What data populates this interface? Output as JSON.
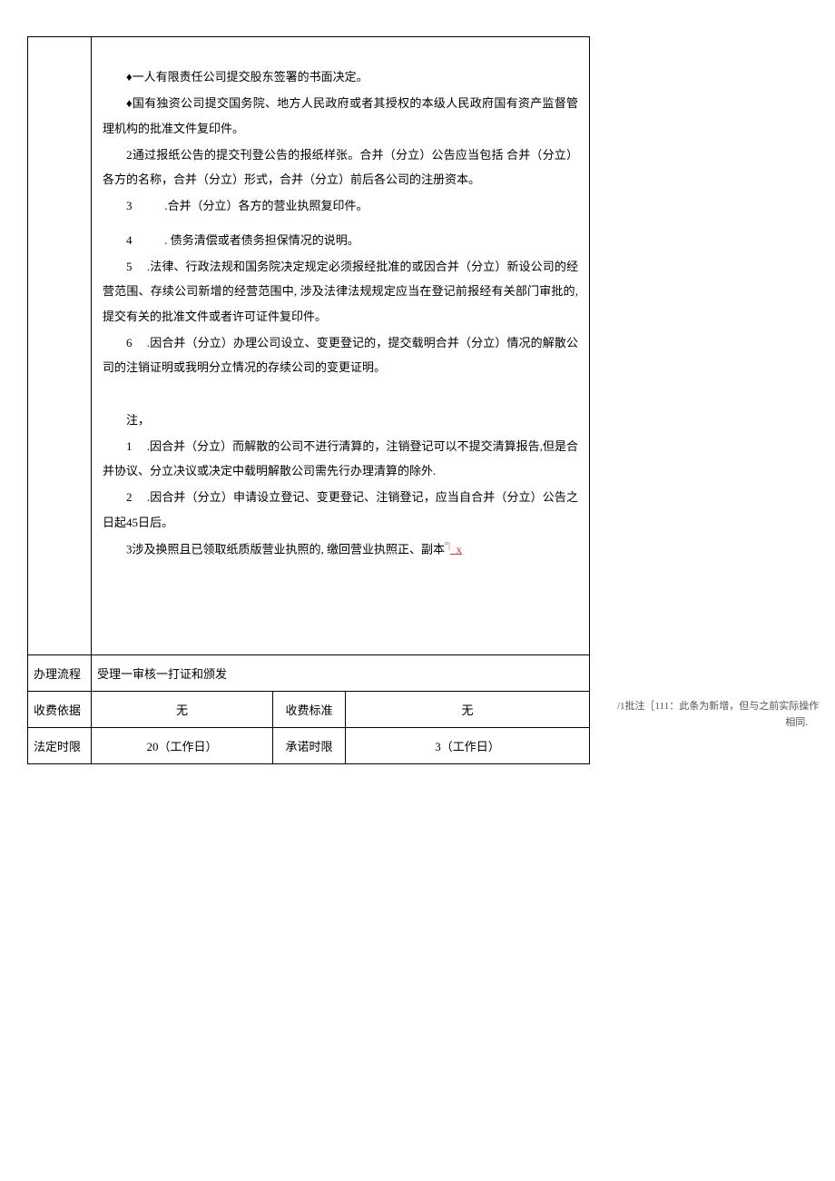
{
  "content": {
    "bullets": [
      "♦一人有限责任公司提交股东签署的书面决定。",
      "♦国有独资公司提交国务院、地方人民政府或者其授权的本级人民政府国有资产监督管理机构的批准文件复印件。"
    ],
    "items": [
      {
        "num": "2",
        "text": ".通过报纸公告的提交刊登公告的报纸样张。合并（分立）公告应当包括 合并（分立）各方的名称，合并（分立）形式，合并（分立）前后各公司的注册资本。"
      },
      {
        "num": "3",
        "text": ".合并（分立）各方的营业执照复印件。"
      },
      {
        "num": "4",
        "text": ". 债务清偿或者债务担保情况的说明。"
      },
      {
        "num": "5",
        "text": ".法律、行政法规和国务院决定规定必须报经批准的或因合并（分立）新设公司的经营范围、存续公司新增的经营范围中, 涉及法律法规规定应当在登记前报经有关部门审批的, 提交有关的批准文件或者许可证件复印件。"
      },
      {
        "num": "6",
        "text": ".因合并（分立）办理公司设立、变更登记的，提交载明合并（分立）情况的解散公司的注销证明或我明分立情况的存续公司的变更证明。"
      }
    ],
    "note_label": "注，",
    "notes": [
      {
        "num": "1",
        "text": ".因合并（分立）而解散的公司不进行清算的，注销登记可以不提交清算报告,但是合并协议、分立决议或决定中载明解散公司需先行办理清算的除外."
      },
      {
        "num": "2",
        "text": ".因合并（分立）申请设立登记、变更登记、注销登记，应当自合并（分立）公告之日起45日后。"
      }
    ],
    "note3_prefix": "3涉及换照且已领取纸质版营业执照的, 缴回营业执照正、副本",
    "note3_sup": "°|",
    "note3_mark": "_x"
  },
  "rows": {
    "proc_label": "办理流程",
    "proc_value": "受理一审核一打证和颁发",
    "fee_basis_label": "收费依据",
    "fee_basis_value": "无",
    "fee_std_label": "收费标准",
    "fee_std_value": "无",
    "legal_time_label": "法定时限",
    "legal_time_value": "20（工作日）",
    "promise_time_label": "承诺时限",
    "promise_time_value": "3（工作日）"
  },
  "annotation": {
    "line1": "/1批注［111：此条为新增，但与之前实际操作",
    "line2": "相同."
  }
}
